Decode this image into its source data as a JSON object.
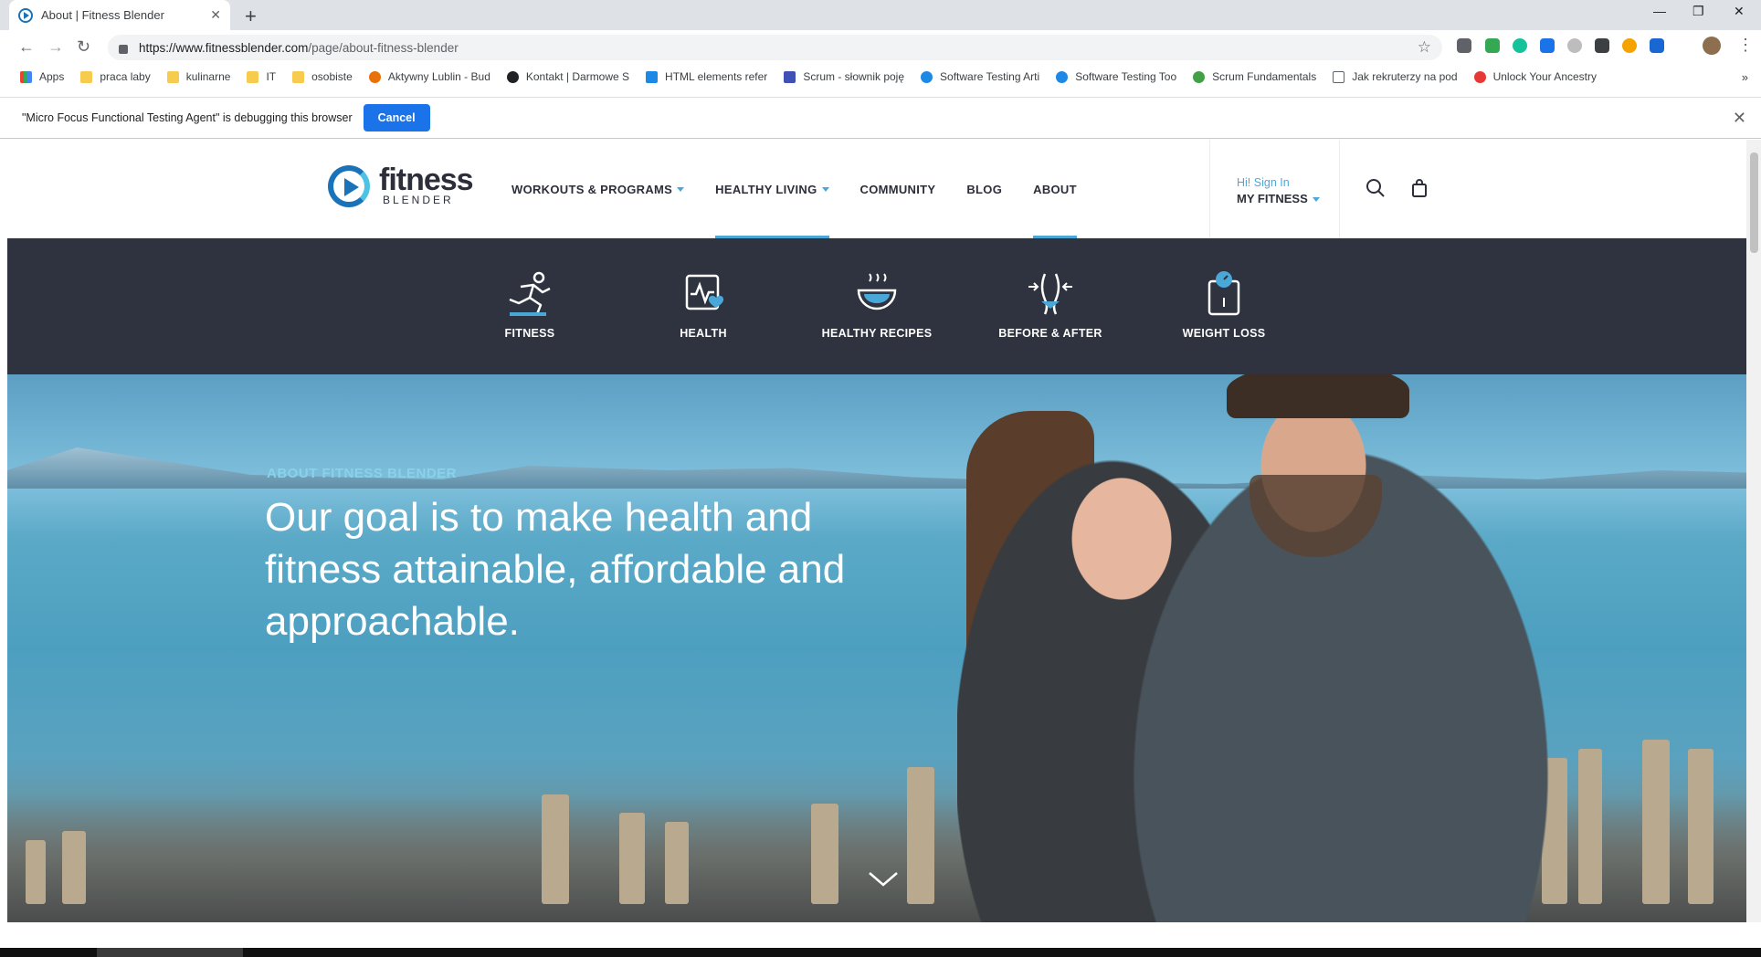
{
  "browser": {
    "tab_title": "About | Fitness Blender",
    "url_host": "https://www.fitnessblender.com",
    "url_path": "/page/about-fitness-blender",
    "bookmarks": [
      "Apps",
      "praca laby",
      "kulinarne",
      "IT",
      "osobiste",
      "Aktywny Lublin - Bud",
      "Kontakt | Darmowe S",
      "HTML elements refer",
      "Scrum - słownik poję",
      "Software Testing Arti",
      "Software Testing Too",
      "Scrum Fundamentals",
      "Jak rekruterzy na pod",
      "Unlock Your Ancestry"
    ],
    "debug_message": "\"Micro Focus Functional Testing Agent\" is debugging this browser",
    "debug_cancel": "Cancel"
  },
  "site": {
    "logo_word": "fitness",
    "logo_sub": "BLENDER",
    "nav": [
      {
        "label": "WORKOUTS & PROGRAMS"
      },
      {
        "label": "HEALTHY LIVING"
      },
      {
        "label": "COMMUNITY"
      },
      {
        "label": "BLOG"
      },
      {
        "label": "ABOUT"
      }
    ],
    "signin_hi": "Hi! Sign In",
    "my_fitness": "MY FITNESS",
    "subnav": [
      {
        "label": "FITNESS",
        "icon": "runner-icon"
      },
      {
        "label": "HEALTH",
        "icon": "heart-monitor-icon"
      },
      {
        "label": "HEALTHY RECIPES",
        "icon": "bowl-icon"
      },
      {
        "label": "BEFORE & AFTER",
        "icon": "waist-icon"
      },
      {
        "label": "WEIGHT LOSS",
        "icon": "scale-icon"
      }
    ],
    "hero_eyebrow": "ABOUT FITNESS BLENDER",
    "hero_title": "Our goal is to make health and fitness attainable, affordable and approachable."
  },
  "colors": {
    "accent": "#4aa8d8",
    "brand_blue": "#1a73b8",
    "subnav_bg": "#2f323f",
    "chrome_button": "#1a73e8"
  }
}
